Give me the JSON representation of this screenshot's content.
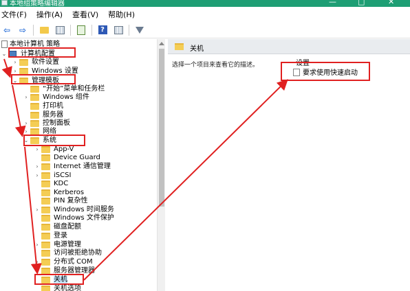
{
  "window": {
    "title": "本地组策略编辑器",
    "minimize_glyph": "—",
    "restore_glyph": "□",
    "close_glyph": "✕"
  },
  "menu": {
    "items": [
      "文件(F)",
      "操作(A)",
      "查看(V)",
      "帮助(H)"
    ]
  },
  "toolbar": {
    "icons": [
      "back-arrow-icon",
      "forward-arrow-icon",
      "up-folder-icon",
      "show-tree-icon",
      "export-icon",
      "help-icon",
      "properties-icon",
      "filter-icon"
    ],
    "back_glyph": "⇦",
    "forward_glyph": "⇨"
  },
  "tree": {
    "root": "本地计算机 策略",
    "computer_config": "计算机配置",
    "software_settings": "软件设置",
    "windows_settings": "Windows 设置",
    "admin_templates": "管理模板",
    "start_menu": "“开始”菜单和任务栏",
    "windows_components": "Windows 组件",
    "printers": "打印机",
    "servers": "服务器",
    "control_panel": "控制面板",
    "network": "网络",
    "system": "系统",
    "system_children": [
      "App-V",
      "Device Guard",
      "Internet 通信管理",
      "iSCSI",
      "KDC",
      "Kerberos",
      "PIN 复杂性",
      "Windows 时间服务",
      "Windows 文件保护",
      "磁盘配额",
      "登录",
      "电源管理",
      "访问被拒绝协助",
      "分布式 COM",
      "服务器管理器",
      "关机",
      "关机选项"
    ],
    "expanded_glyph": "⌄",
    "collapsed_glyph": "›"
  },
  "right_pane": {
    "header": "关机",
    "description": "选择一个项目来查看它的描述。",
    "settings_header": "设置",
    "settings_items": [
      "要求使用快速启动"
    ]
  },
  "annotation_color": "#e02020"
}
